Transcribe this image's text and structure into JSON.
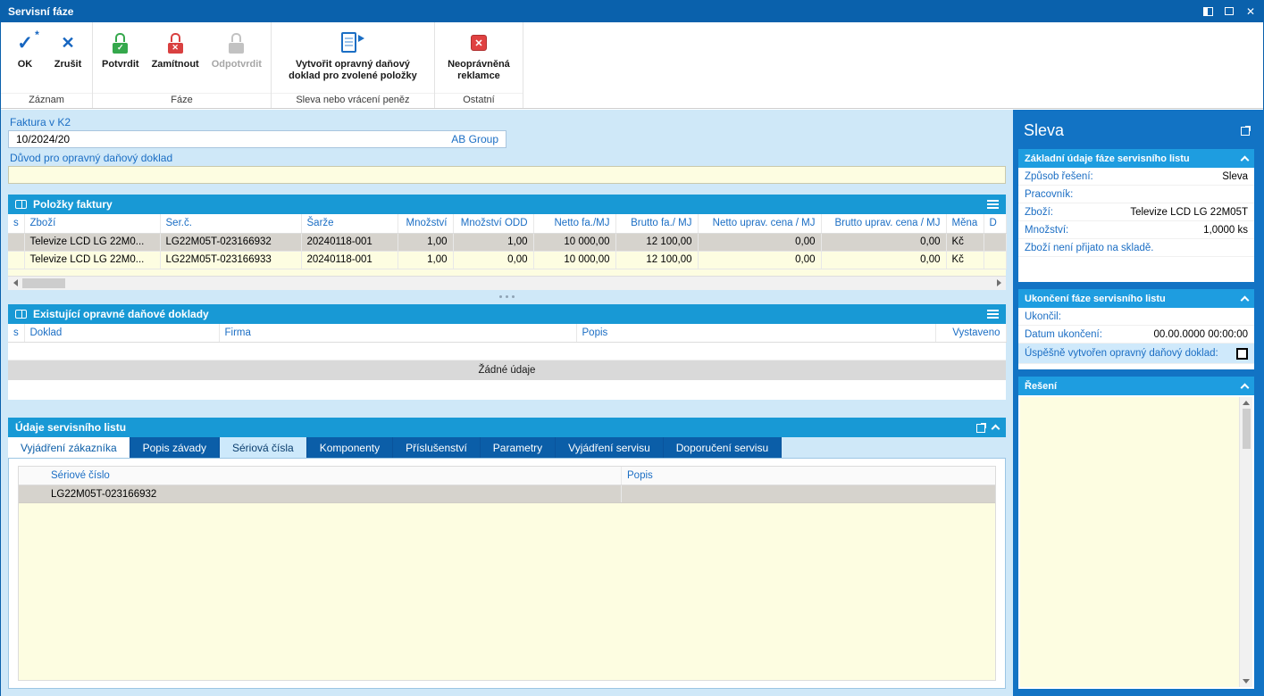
{
  "colors": {
    "titlebar": "#0a61ac",
    "section_header": "#1899d5",
    "sidebar_bg": "#1273c4",
    "panel_header": "#1e9de0",
    "label_blue": "#1b6ec4",
    "field_yellow": "#fdfde1",
    "selected_row": "#d6d3cd",
    "tab_dark": "#0b5ea8",
    "tab_active": "#cde9fb",
    "workspace_bg": "#cfe8f8",
    "confirm_green": "#35a84c",
    "reject_red": "#d94040"
  },
  "window": {
    "title": "Servisní fáze"
  },
  "toolbar": {
    "groups": [
      {
        "label": "Záznam",
        "buttons": [
          {
            "label": "OK",
            "icon": "ok-check-icon"
          },
          {
            "label": "Zrušit",
            "icon": "cancel-x-icon"
          }
        ]
      },
      {
        "label": "Fáze",
        "buttons": [
          {
            "label": "Potvrdit",
            "icon": "confirm-lock-icon"
          },
          {
            "label": "Zamítnout",
            "icon": "reject-lock-icon"
          },
          {
            "label": "Odpotvrdit",
            "icon": "unconfirm-lock-icon",
            "disabled": true
          }
        ]
      },
      {
        "label": "Sleva nebo vrácení peněz",
        "buttons": [
          {
            "label": "Vytvořit opravný daňový doklad pro zvolené položky",
            "icon": "create-credit-note-icon"
          }
        ]
      },
      {
        "label": "Ostatní",
        "buttons": [
          {
            "label": "Neoprávněná reklamce",
            "icon": "unjustified-claim-icon"
          }
        ]
      }
    ]
  },
  "form": {
    "invoice_label": "Faktura v K2",
    "invoice_value": "10/2024/20",
    "invoice_company": "AB Group",
    "reason_label": "Důvod pro opravný daňový doklad",
    "reason_value": ""
  },
  "invoice_items": {
    "title": "Položky faktury",
    "columns": [
      "s",
      "Zboží",
      "Ser.č.",
      "Šarže",
      "Množství",
      "Množství ODD",
      "Netto fa./MJ",
      "Brutto fa./ MJ",
      "Netto uprav. cena / MJ",
      "Brutto uprav. cena / MJ",
      "Měna",
      "D"
    ],
    "rows": [
      [
        "",
        "Televize LCD LG 22M0...",
        "LG22M05T-023166932",
        "20240118-001",
        "1,00",
        "1,00",
        "10 000,00",
        "12 100,00",
        "0,00",
        "0,00",
        "Kč",
        ""
      ],
      [
        "",
        "Televize LCD LG 22M0...",
        "LG22M05T-023166933",
        "20240118-001",
        "1,00",
        "0,00",
        "10 000,00",
        "12 100,00",
        "0,00",
        "0,00",
        "Kč",
        ""
      ]
    ]
  },
  "credit_notes": {
    "title": "Existující opravné daňové doklady",
    "columns": [
      "s",
      "Doklad",
      "Firma",
      "Popis",
      "Vystaveno"
    ],
    "empty_text": "Žádné údaje"
  },
  "service_sheet": {
    "title": "Údaje servisního listu",
    "tabs": [
      {
        "label": "Vyjádření zákazníka",
        "state": "light"
      },
      {
        "label": "Popis závady",
        "state": "dark"
      },
      {
        "label": "Sériová čísla",
        "state": "active"
      },
      {
        "label": "Komponenty",
        "state": "dark"
      },
      {
        "label": "Příslušenství",
        "state": "dark"
      },
      {
        "label": "Parametry",
        "state": "dark"
      },
      {
        "label": "Vyjádření servisu",
        "state": "dark"
      },
      {
        "label": "Doporučení servisu",
        "state": "dark"
      }
    ],
    "serials": {
      "columns": [
        "Sériové číslo",
        "Popis"
      ],
      "rows": [
        [
          "LG22M05T-023166932",
          ""
        ]
      ]
    }
  },
  "sidebar": {
    "title": "Sleva",
    "basic": {
      "title": "Základní údaje fáze servisního listu",
      "rows": [
        {
          "label": "Způsob řešení:",
          "value": "Sleva"
        },
        {
          "label": "Pracovník:",
          "value": ""
        },
        {
          "label": "Zboží:",
          "value": "Televize LCD LG 22M05T"
        },
        {
          "label": "Množství:",
          "value": "1,0000 ks"
        }
      ],
      "note": "Zboží není přijato na skladě."
    },
    "closing": {
      "title": "Ukončení fáze servisního listu",
      "rows": [
        {
          "label": "Ukončil:",
          "value": ""
        },
        {
          "label": "Datum ukončení:",
          "value": "00.00.0000 00:00:00"
        }
      ],
      "checkbox_label": "Úspěšně vytvořen opravný daňový doklad:",
      "checkbox_checked": false
    },
    "solution": {
      "title": "Řešení",
      "value": ""
    }
  }
}
